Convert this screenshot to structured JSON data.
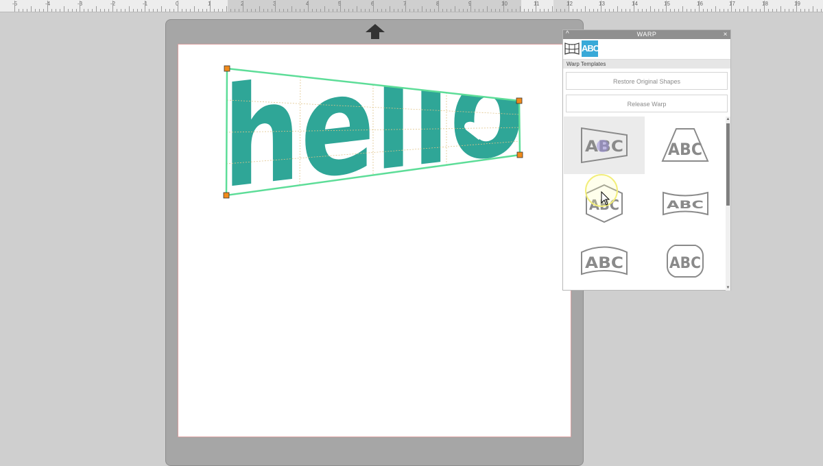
{
  "ruler": {
    "labels": [
      "-5",
      "-4",
      "-3",
      "-2",
      "-1",
      "0",
      "1",
      "2",
      "3",
      "4",
      "5",
      "6",
      "7",
      "8",
      "9",
      "10",
      "11",
      "12",
      "13",
      "14",
      "15",
      "16",
      "17",
      "18",
      "19"
    ]
  },
  "canvas": {
    "text": "hello",
    "text_color": "#2fa697",
    "warp_frame_color": "#5ddd98"
  },
  "warp_panel": {
    "title": "WARP",
    "collapse_glyph": "^",
    "close_glyph": "×",
    "tabs": [
      {
        "name": "grid-warp",
        "label": ""
      },
      {
        "name": "abc-warp",
        "label": "ABC"
      }
    ],
    "section_label": "Warp Templates",
    "restore_label": "Restore Original Shapes",
    "release_label": "Release Warp",
    "templates": [
      {
        "label": "ABC",
        "shape": "trapezoid-narrow-right",
        "selected": true
      },
      {
        "label": "ABC",
        "shape": "trapezoid-up"
      },
      {
        "label": "ABC",
        "shape": "hexagon"
      },
      {
        "label": "ABC",
        "shape": "bowtie"
      },
      {
        "label": "ABC",
        "shape": "arch"
      },
      {
        "label": "ABC",
        "shape": "rounded-octagon"
      }
    ],
    "accent_color": "#38a9d8"
  }
}
